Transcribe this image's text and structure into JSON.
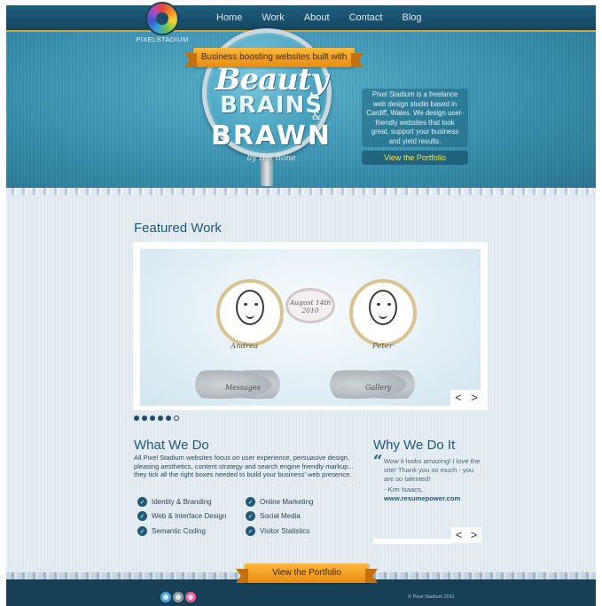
{
  "nav": {
    "logo_text": "PIXELSTADIUM",
    "items": [
      {
        "label": "Home"
      },
      {
        "label": "Work"
      },
      {
        "label": "About"
      },
      {
        "label": "Contact"
      },
      {
        "label": "Blog"
      }
    ]
  },
  "hero": {
    "ribbon": "Business boosting websites built with",
    "headline_beauty": "Beauty",
    "headline_brains": "BRAINS",
    "headline_amp": "&",
    "headline_brawn": "BRAWN",
    "byline": "by Bill Bone",
    "intro": "Pixel Stadium is a freelance web design studio based in Cardiff, Wales. We design user-friendly websites that look great, support your business and yield results.",
    "cta": "View the Portfolio"
  },
  "featured": {
    "title": "Featured Work",
    "slide": {
      "date": "August 14th 2010",
      "name_left": "Andrea",
      "name_right": "Peter",
      "label_left": "Messages",
      "label_right": "Gallery"
    },
    "arrows": {
      "prev": "<",
      "next": ">"
    },
    "dots_total": 6,
    "dots_active_index": 5
  },
  "what_we_do": {
    "title": "What We Do",
    "body": "All Pixel Stadium websites focus on user experience, persuasive design, pleasing aesthetics, content strategy and search engine friendly markup... they tick all the right boxes needed to build your business' web presence.",
    "services_left": [
      "Identity & Branding",
      "Web & Interface Design",
      "Semantic Coding"
    ],
    "services_right": [
      "Online Marketing",
      "Social Media",
      "Visitor Statistics"
    ],
    "check_glyph": "✓"
  },
  "why_we_do_it": {
    "title": "Why We Do It",
    "quote_mark": "“",
    "quote": "Wow it looks amazing! I love the site! Thank you so much - you are so talented!",
    "author": "- Kim Isaacs,",
    "link": "www.resumepower.com",
    "arrows": {
      "prev": "<",
      "next": ">"
    }
  },
  "footer": {
    "ribbon": "View the Portfolio",
    "social": [
      "twitter-icon",
      "flickr-icon",
      "dribbble-icon"
    ],
    "copyright": "© Pixel Stadium 2011"
  }
}
